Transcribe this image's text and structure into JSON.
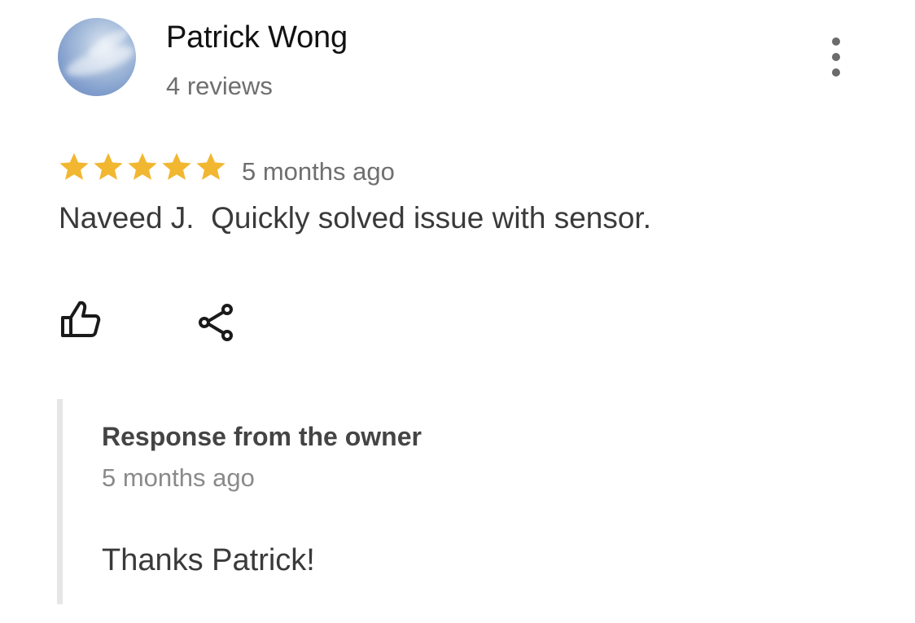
{
  "reviewer": {
    "name": "Patrick Wong",
    "review_count": "4 reviews",
    "avatar_icon": "sky-photo-avatar"
  },
  "more_menu": {
    "icon": "more-vertical-icon"
  },
  "review": {
    "rating": 5,
    "rating_max": 5,
    "star_color": "#F2B731",
    "date": "5 months ago",
    "text": "Naveed J.  Quickly solved issue with sensor."
  },
  "actions": {
    "like_icon": "thumbs-up-icon",
    "share_icon": "share-icon"
  },
  "owner_response": {
    "title": "Response from the owner",
    "date": "5 months ago",
    "text": "Thanks Patrick!"
  }
}
